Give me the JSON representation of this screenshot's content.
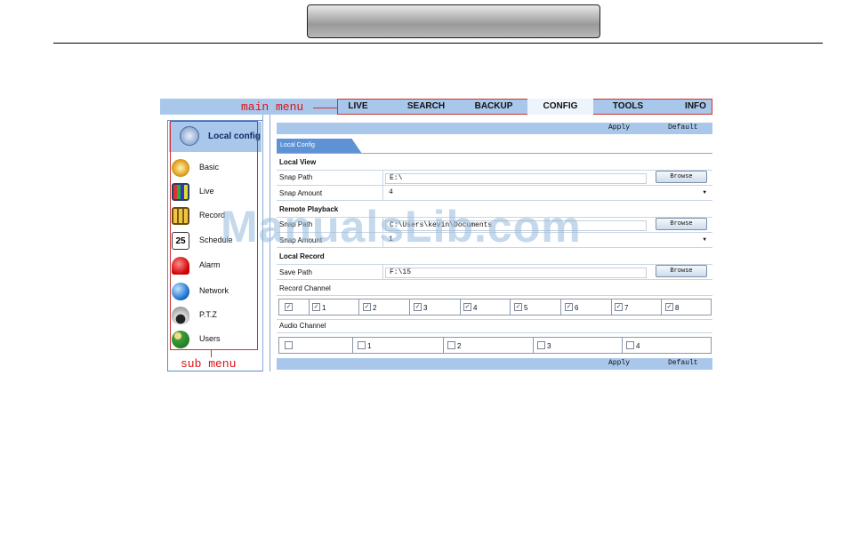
{
  "annotations": {
    "main_menu": "main menu",
    "sub_menu": "sub menu"
  },
  "watermark": "ManualsLib.com",
  "menu": [
    {
      "label": "LIVE"
    },
    {
      "label": "SEARCH"
    },
    {
      "label": "BACKUP"
    },
    {
      "label": "CONFIG",
      "active": true
    },
    {
      "label": "TOOLS"
    },
    {
      "label": "INFO"
    }
  ],
  "sidebar": {
    "header": "Local config",
    "items": [
      {
        "label": "Basic",
        "icon": "gear-icon"
      },
      {
        "label": "Live",
        "icon": "monitor-icon"
      },
      {
        "label": "Record",
        "icon": "film-icon"
      },
      {
        "label": "Schedule",
        "icon": "calendar-icon",
        "badge": "25"
      },
      {
        "label": "Alarm",
        "icon": "alarm-icon"
      },
      {
        "label": "Network",
        "icon": "globe-icon"
      },
      {
        "label": "P.T.Z",
        "icon": "dome-camera-icon"
      },
      {
        "label": "Users",
        "icon": "users-icon"
      }
    ]
  },
  "toolbar": {
    "apply": "Apply",
    "default": "Default"
  },
  "tab": "Local Config",
  "local_view": {
    "title": "Local View",
    "snap_path_label": "Snap Path",
    "snap_path": "E:\\",
    "snap_amount_label": "Snap Amount",
    "snap_amount": "4"
  },
  "remote_playback": {
    "title": "Remote Playback",
    "snap_path_label": "Snap Path",
    "snap_path": "C:\\Users\\kevin\\Documents",
    "snap_amount_label": "Snap Amount",
    "snap_amount": "1"
  },
  "local_record": {
    "title": "Local Record",
    "save_path_label": "Save Path",
    "save_path": "F:\\15",
    "record_channel_label": "Record Channel",
    "audio_channel_label": "Audio Channel"
  },
  "browse": "Browse",
  "record_channels": [
    "",
    "1",
    "2",
    "3",
    "4",
    "5",
    "6",
    "7",
    "8"
  ],
  "audio_channels": [
    "",
    "1",
    "2",
    "3",
    "4"
  ]
}
